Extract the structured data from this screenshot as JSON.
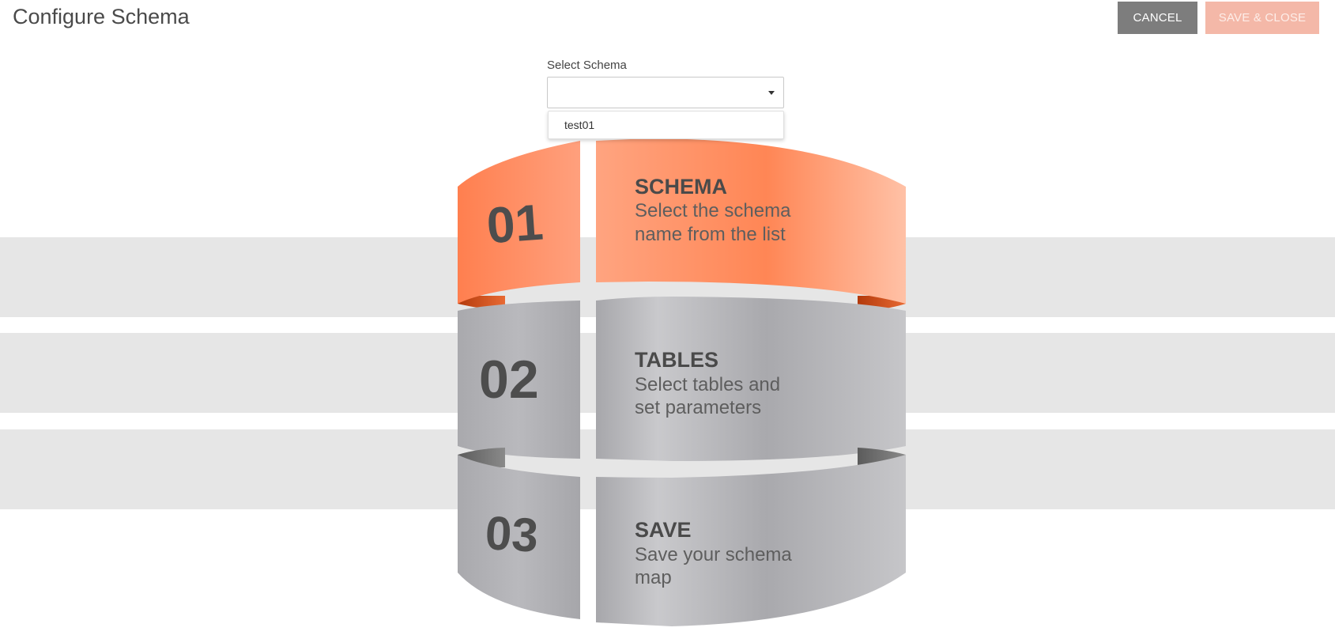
{
  "header": {
    "title": "Configure Schema",
    "cancel_label": "CANCEL",
    "save_label": "SAVE & CLOSE"
  },
  "schema_select": {
    "label": "Select Schema",
    "value": "",
    "options": [
      "test01"
    ]
  },
  "steps": [
    {
      "number": "01",
      "title": "SCHEMA",
      "desc_line1": "Select the schema",
      "desc_line2": "name from the list",
      "state": "active"
    },
    {
      "number": "02",
      "title": "TABLES",
      "desc_line1": "Select tables and",
      "desc_line2": "set parameters",
      "state": "inactive"
    },
    {
      "number": "03",
      "title": "SAVE",
      "desc_line1": "Save your schema",
      "desc_line2": "map",
      "state": "inactive"
    }
  ],
  "colors": {
    "active_accent": "#ff8a5c",
    "inactive_band": "#b4b4b8",
    "background_band": "#e6e6e6",
    "cancel_button": "#7d7d7d",
    "save_button": "#f4b8a8"
  }
}
